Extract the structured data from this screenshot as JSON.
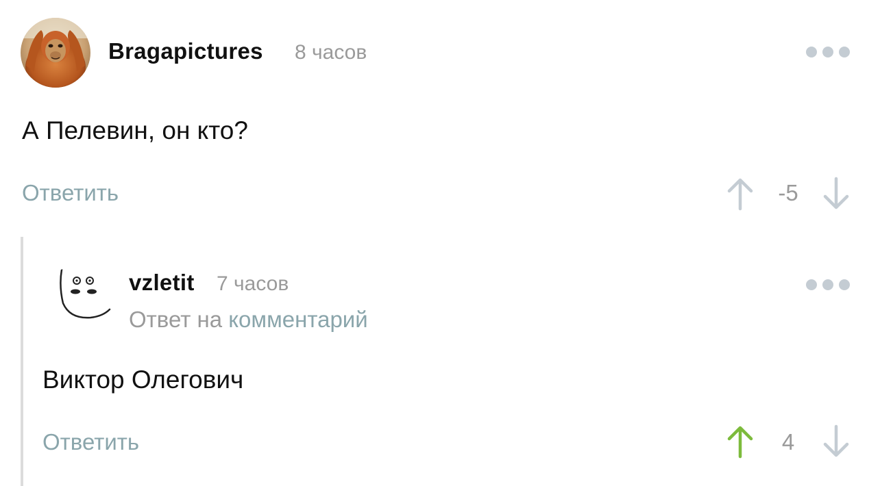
{
  "comments": [
    {
      "author": "Bragapictures",
      "time": "8 часов",
      "text": "А Пелевин, он кто?",
      "reply_label": "Ответить",
      "rating": "-5",
      "avatar": "orangutan-avatar-image"
    },
    {
      "author": "vzletit",
      "time": "7 часов",
      "reply_to_prefix": "Ответ на",
      "reply_to_link": "комментарий",
      "text": "Виктор Олегович",
      "reply_label": "Ответить",
      "rating": "4",
      "avatar": "doodle-face-avatar-image"
    }
  ],
  "icons": {
    "more": "more-dots-icon",
    "upvote": "arrow-up-icon",
    "downvote": "arrow-down-icon"
  },
  "colors": {
    "upvote_active": "#7dbb3c",
    "arrow_inactive": "#c4ccd3",
    "link": "#8aa5ab",
    "muted": "#9a9a9a"
  }
}
